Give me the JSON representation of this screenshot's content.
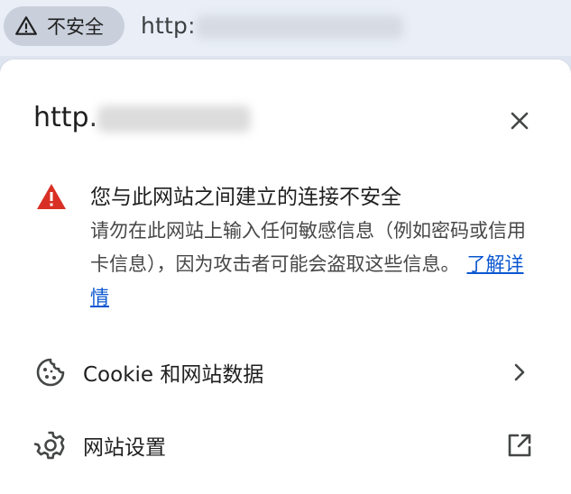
{
  "omnibox": {
    "security_chip_label": "不安全",
    "url_prefix": "http:"
  },
  "popup": {
    "title_prefix": "http.",
    "warning": {
      "heading": "您与此网站之间建立的连接不安全",
      "body": "请勿在此网站上输入任何敏感信息（例如密码或信用卡信息），因为攻击者可能会盗取这些信息。",
      "learn_more": "了解详情"
    },
    "rows": [
      {
        "label": "Cookie 和网站数据",
        "icon": "cookie-icon",
        "trailing": "chevron-right-icon"
      },
      {
        "label": "网站设置",
        "icon": "gear-icon",
        "trailing": "open-in-new-icon"
      }
    ]
  },
  "colors": {
    "warning_red": "#d93025",
    "link_blue": "#0b57d0",
    "chip_bg": "#c9d0dc",
    "omnibox_bg": "#e9eef7"
  }
}
